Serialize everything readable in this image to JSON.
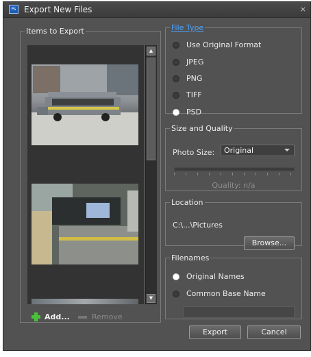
{
  "window": {
    "title": "Export New Files",
    "close_glyph": "×",
    "app_icon": "Ps"
  },
  "items_group": {
    "legend": "Items to Export",
    "add_label": "Add...",
    "remove_label": "Remove"
  },
  "file_type": {
    "legend": "File Type",
    "options": [
      "Use Original Format",
      "JPEG",
      "PNG",
      "TIFF",
      "PSD"
    ],
    "selected": "PSD"
  },
  "size_quality": {
    "legend": "Size and Quality",
    "photo_size_label": "Photo Size:",
    "photo_size_value": "Original",
    "quality_text": "Quality: n/a"
  },
  "location": {
    "legend": "Location",
    "path": "C:\\...\\Pictures",
    "browse_label": "Browse..."
  },
  "filenames": {
    "legend": "Filenames",
    "options": [
      "Original Names",
      "Common Base Name"
    ],
    "selected": "Original Names",
    "base_name_value": ""
  },
  "footer": {
    "export_label": "Export",
    "cancel_label": "Cancel"
  },
  "colors": {
    "accent_link": "#4aa3ff",
    "add_icon": "#49c23a",
    "panel": "#525252"
  }
}
